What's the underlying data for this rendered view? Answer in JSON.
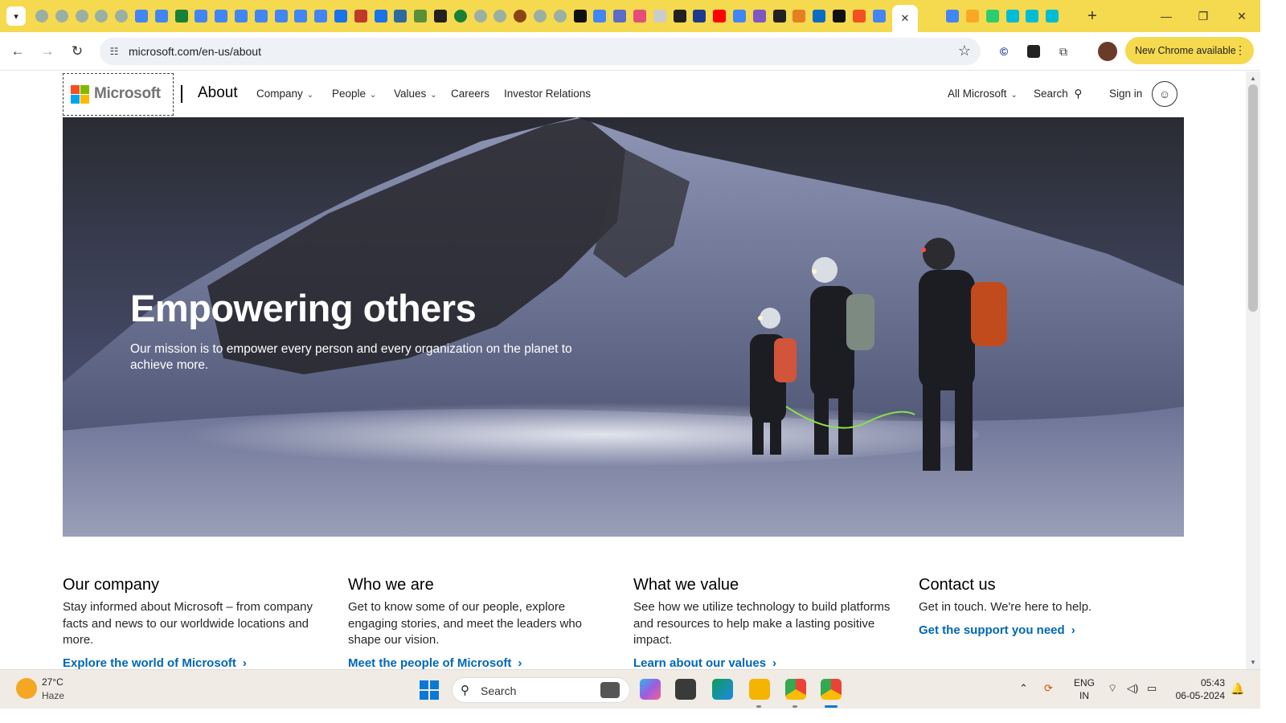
{
  "browser": {
    "url": "microsoft.com/en-us/about",
    "update_button": "New Chrome available",
    "tab_favicon_colors": [
      "#9ab0a3",
      "#9ab0a3",
      "#9ab0a3",
      "#9ab0a3",
      "#9ab0a3",
      "#4285f4",
      "#4285f4",
      "#188038",
      "#4285f4",
      "#4285f4",
      "#4285f4",
      "#4285f4",
      "#4285f4",
      "#4285f4",
      "#4285f4",
      "#1a73e8",
      "#c0392b",
      "#1a73e8",
      "#2d6a9f",
      "#5a8f3a",
      "#222222",
      "#188038",
      "#9ab0a3",
      "#9ab0a3",
      "#8b4513",
      "#9ab0a3",
      "#9ab0a3",
      "#111111",
      "#4285f4",
      "#5b6cc6",
      "#e44d7a",
      "#cccccc",
      "#222222",
      "#1e3a8a",
      "#ff0000",
      "#4285f4",
      "#7e57c2",
      "#222222",
      "#e67e22",
      "#0a6cc4",
      "#111111",
      "#f25022",
      "#4285f4",
      "#e67e22",
      "#4285f4",
      "#f9a825",
      "#2ecc71",
      "#00bcd4",
      "#00bcd4",
      "#00bcd4"
    ]
  },
  "header": {
    "logo_text": "Microsoft",
    "section": "About",
    "nav": [
      {
        "label": "Company",
        "dropdown": true
      },
      {
        "label": "People",
        "dropdown": true
      },
      {
        "label": "Values",
        "dropdown": true
      },
      {
        "label": "Careers",
        "dropdown": false
      },
      {
        "label": "Investor Relations",
        "dropdown": false
      }
    ],
    "all_microsoft": "All Microsoft",
    "search": "Search",
    "sign_in": "Sign in"
  },
  "hero": {
    "title": "Empowering others",
    "text": "Our mission is to empower every person and every organization on the planet to achieve more."
  },
  "cards": [
    {
      "title": "Our company",
      "text": "Stay informed about Microsoft – from company facts and news to our worldwide locations and more.",
      "link": "Explore the world of Microsoft"
    },
    {
      "title": "Who we are",
      "text": "Get to know some of our people, explore engaging stories, and meet the leaders who shape our vision.",
      "link": "Meet the people of Microsoft"
    },
    {
      "title": "What we value",
      "text": "See how we utilize technology to build platforms and resources to help make a lasting positive impact.",
      "link": "Learn about our values"
    },
    {
      "title": "Contact us",
      "text": "Get in touch. We're here to help.",
      "link": "Get the support you need"
    }
  ],
  "taskbar": {
    "temperature": "27°C",
    "condition": "Haze",
    "search": "Search",
    "lang_line1": "ENG",
    "lang_line2": "IN",
    "time": "05:43",
    "date": "06-05-2024"
  },
  "colors": {
    "chrome_accent": "#f5d94e",
    "link_blue": "#0067b8"
  }
}
